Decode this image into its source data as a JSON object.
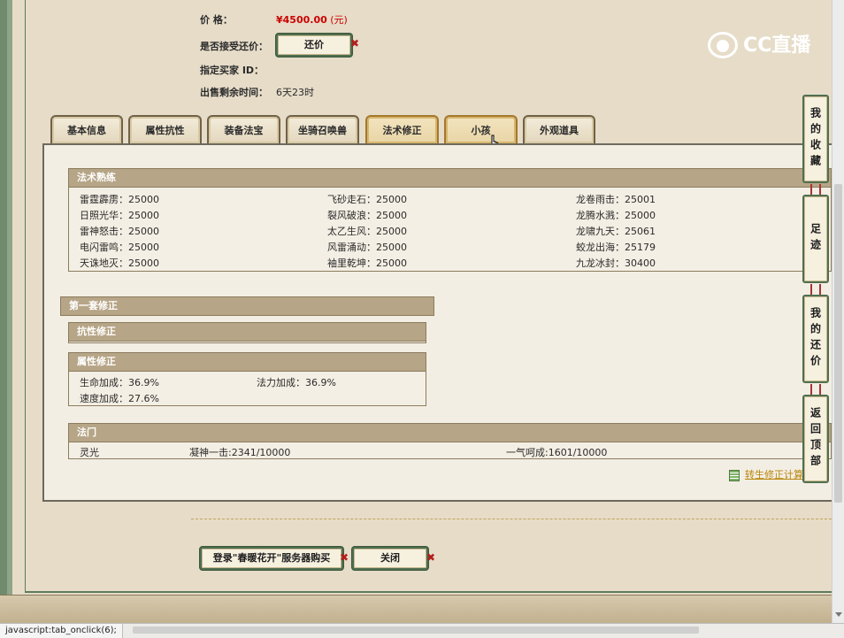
{
  "info": {
    "price_label": "价 格：",
    "price_value": "¥4500.00",
    "price_unit": "(元)",
    "bargain_label": "是否接受还价：",
    "bargain_button": "还价",
    "buyer_label": "指定买家 ID：",
    "buyer_value": "",
    "remaining_label": "出售剩余时间：",
    "remaining_value": "6天23时"
  },
  "logo": {
    "text": "CC直播"
  },
  "tabs": [
    {
      "label": "基本信息"
    },
    {
      "label": "属性抗性"
    },
    {
      "label": "装备法宝"
    },
    {
      "label": "坐骑召唤兽"
    },
    {
      "label": "法术修正",
      "active": true
    },
    {
      "label": "小孩",
      "active": true
    },
    {
      "label": "外观道具"
    }
  ],
  "spell_mastery": {
    "title": "法术熟练",
    "items": [
      "雷霆霹雳：25000",
      "飞砂走石：25000",
      "龙卷雨击：25001",
      "日照光华：25000",
      "裂风破浪：25000",
      "龙腾水溅：25000",
      "雷神怒击：25000",
      "太乙生风：25000",
      "龙啸九天：25061",
      "电闪雷鸣：25000",
      "风雷涌动：25000",
      "蛟龙出海：25179",
      "天诛地灭：25000",
      "袖里乾坤：25000",
      "九龙冰封：30400"
    ]
  },
  "first_set": {
    "title": "第一套修正"
  },
  "resist_fix": {
    "title": "抗性修正"
  },
  "attr_fix": {
    "title": "属性修正",
    "items": [
      "生命加成：36.9%",
      "法力加成：36.9%",
      "速度加成：27.6%"
    ]
  },
  "magic_gate": {
    "title": "法门",
    "items": [
      "灵光",
      "凝神一击:2341/10000",
      "一气呵成:1601/10000"
    ]
  },
  "calc_link": "转生修正计算",
  "buttons": {
    "buy": "登录\"春暖花开\"服务器购买",
    "close": "关闭"
  },
  "side": {
    "favorites": "我的收藏",
    "footprint": "足迹",
    "my_bargain": "我的还价",
    "back_top": "返回顶部"
  },
  "status": {
    "text": "javascript:tab_onclick(6);"
  },
  "colors": {
    "price": "#cc0000",
    "panel_header": "#b6a586",
    "accent_border": "#4f6f4f"
  }
}
